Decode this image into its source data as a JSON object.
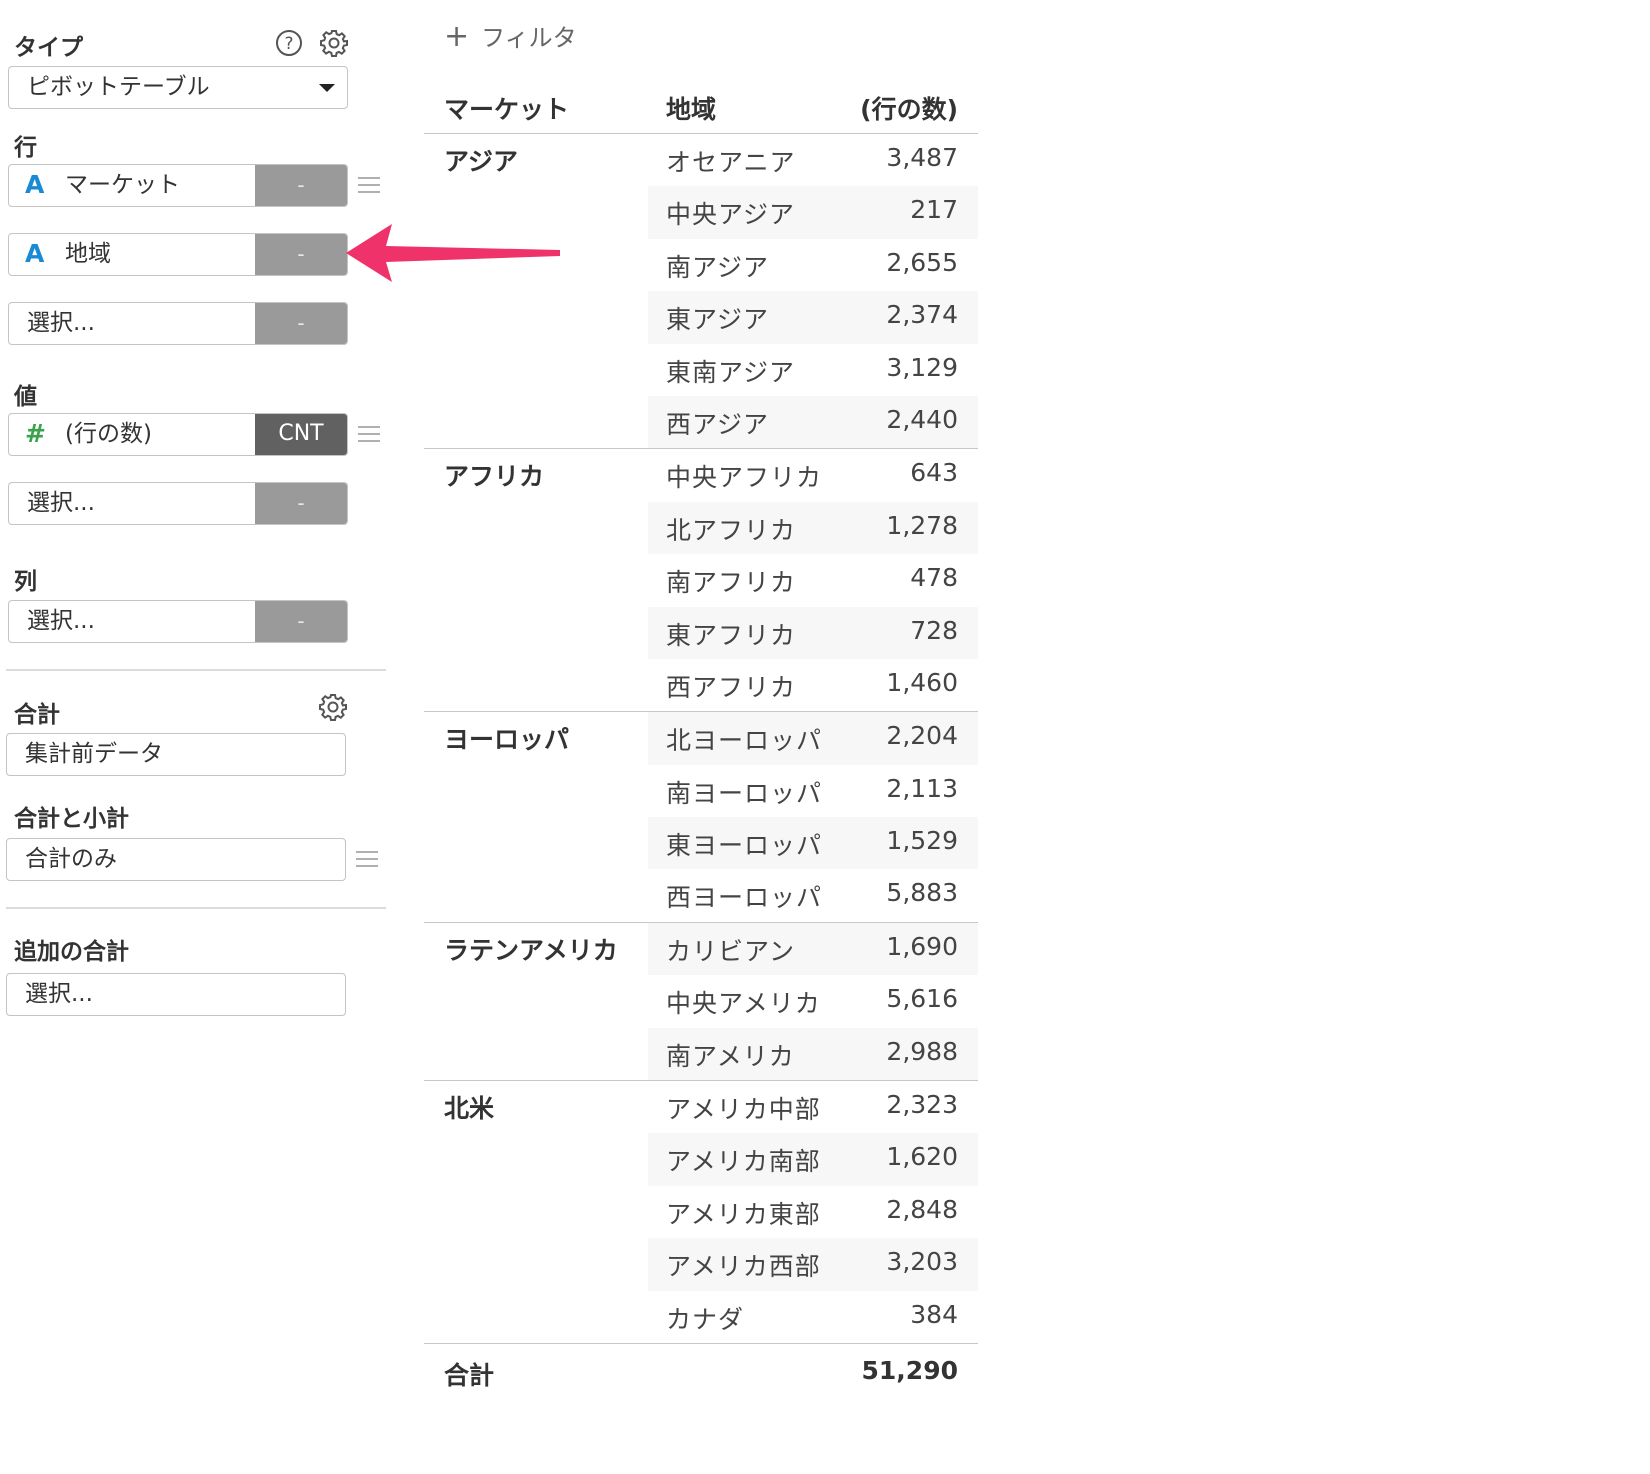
{
  "panel": {
    "type_label": "タイプ",
    "type_value": "ピボットテーブル",
    "rows_label": "行",
    "rows": [
      {
        "type_icon": "A",
        "name": "マーケット",
        "agg": "-"
      },
      {
        "type_icon": "A",
        "name": "地域",
        "agg": "-"
      },
      {
        "type_icon": "",
        "name": "選択...",
        "agg": "-"
      }
    ],
    "values_label": "値",
    "values": [
      {
        "type_icon": "#",
        "name": "(行の数)",
        "agg": "CNT"
      },
      {
        "type_icon": "",
        "name": "選択...",
        "agg": "-"
      }
    ],
    "columns_label": "列",
    "columns": [
      {
        "type_icon": "",
        "name": "選択...",
        "agg": "-"
      }
    ],
    "total_label": "合計",
    "total_value": "集計前データ",
    "subtotal_label": "合計と小計",
    "subtotal_value": "合計のみ",
    "extra_total_label": "追加の合計",
    "extra_total_value": "選択..."
  },
  "filter": {
    "label": "フィルタ"
  },
  "table": {
    "headers": [
      "マーケット",
      "地域",
      "(行の数)"
    ],
    "groups": [
      {
        "market": "アジア",
        "rows": [
          {
            "region": "オセアニア",
            "count": "3,487"
          },
          {
            "region": "中央アジア",
            "count": "217"
          },
          {
            "region": "南アジア",
            "count": "2,655"
          },
          {
            "region": "東アジア",
            "count": "2,374"
          },
          {
            "region": "東南アジア",
            "count": "3,129"
          },
          {
            "region": "西アジア",
            "count": "2,440"
          }
        ]
      },
      {
        "market": "アフリカ",
        "rows": [
          {
            "region": "中央アフリカ",
            "count": "643"
          },
          {
            "region": "北アフリカ",
            "count": "1,278"
          },
          {
            "region": "南アフリカ",
            "count": "478"
          },
          {
            "region": "東アフリカ",
            "count": "728"
          },
          {
            "region": "西アフリカ",
            "count": "1,460"
          }
        ]
      },
      {
        "market": "ヨーロッパ",
        "rows": [
          {
            "region": "北ヨーロッパ",
            "count": "2,204"
          },
          {
            "region": "南ヨーロッパ",
            "count": "2,113"
          },
          {
            "region": "東ヨーロッパ",
            "count": "1,529"
          },
          {
            "region": "西ヨーロッパ",
            "count": "5,883"
          }
        ]
      },
      {
        "market": "ラテンアメリカ",
        "rows": [
          {
            "region": "カリビアン",
            "count": "1,690"
          },
          {
            "region": "中央アメリカ",
            "count": "5,616"
          },
          {
            "region": "南アメリカ",
            "count": "2,988"
          }
        ]
      },
      {
        "market": "北米",
        "rows": [
          {
            "region": "アメリカ中部",
            "count": "2,323"
          },
          {
            "region": "アメリカ南部",
            "count": "1,620"
          },
          {
            "region": "アメリカ東部",
            "count": "2,848"
          },
          {
            "region": "アメリカ西部",
            "count": "3,203"
          },
          {
            "region": "カナダ",
            "count": "384"
          }
        ]
      }
    ],
    "total_label": "合計",
    "total_value": "51,290"
  },
  "colors": {
    "accent_arrow": "#f0326a",
    "string_type": "#1a8ad6",
    "number_type": "#3aa24a"
  }
}
